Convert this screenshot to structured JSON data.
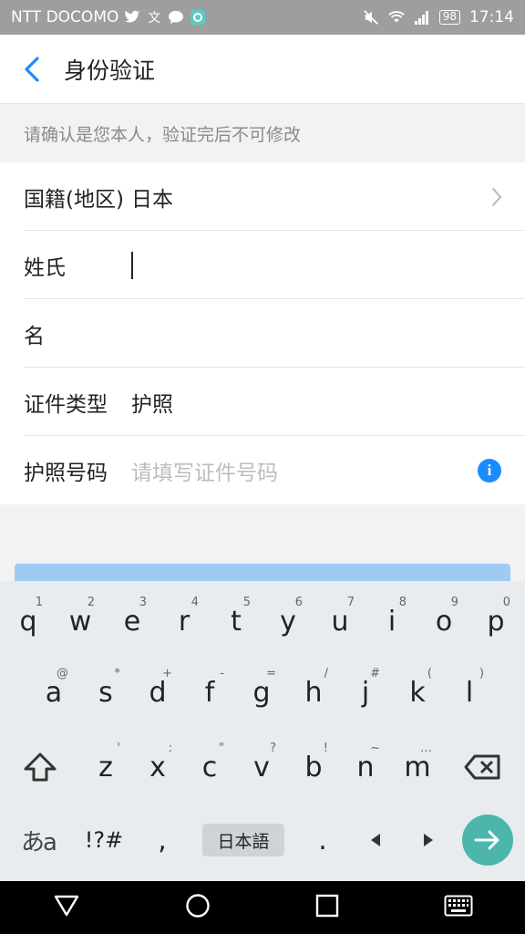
{
  "status": {
    "carrier": "NTT DOCOMO",
    "battery": "98",
    "time": "17:14"
  },
  "header": {
    "title": "身份验证"
  },
  "notice": "请确认是您本人，验证完后不可修改",
  "form": {
    "nationality_label": "国籍(地区)",
    "nationality_value": "日本",
    "surname_label": "姓氏",
    "given_label": "名",
    "id_type_label": "证件类型",
    "id_type_value": "护照",
    "passport_label": "护照号码",
    "passport_placeholder": "请填写证件号码"
  },
  "keyboard": {
    "row1": [
      [
        "q",
        "1"
      ],
      [
        "w",
        "2"
      ],
      [
        "e",
        "3"
      ],
      [
        "r",
        "4"
      ],
      [
        "t",
        "5"
      ],
      [
        "y",
        "6"
      ],
      [
        "u",
        "7"
      ],
      [
        "i",
        "8"
      ],
      [
        "o",
        "9"
      ],
      [
        "p",
        "0"
      ]
    ],
    "row2": [
      [
        "a",
        "@"
      ],
      [
        "s",
        "*"
      ],
      [
        "d",
        "+"
      ],
      [
        "f",
        "-"
      ],
      [
        "g",
        "="
      ],
      [
        "h",
        "/"
      ],
      [
        "j",
        "#"
      ],
      [
        "k",
        "("
      ],
      [
        "l",
        ")"
      ]
    ],
    "row3": [
      [
        "z",
        "'"
      ],
      [
        "x",
        ":"
      ],
      [
        "c",
        "\""
      ],
      [
        "v",
        "?"
      ],
      [
        "b",
        "!"
      ],
      [
        "n",
        "~"
      ],
      [
        "m",
        "…"
      ]
    ],
    "lang_switch": "あa",
    "symbols": "!?#",
    "comma": ",",
    "space": "日本語",
    "period": "."
  },
  "colors": {
    "accent": "#1a8cff",
    "enter_key": "#4db6ac",
    "submit_bar": "#9fcbf3"
  }
}
